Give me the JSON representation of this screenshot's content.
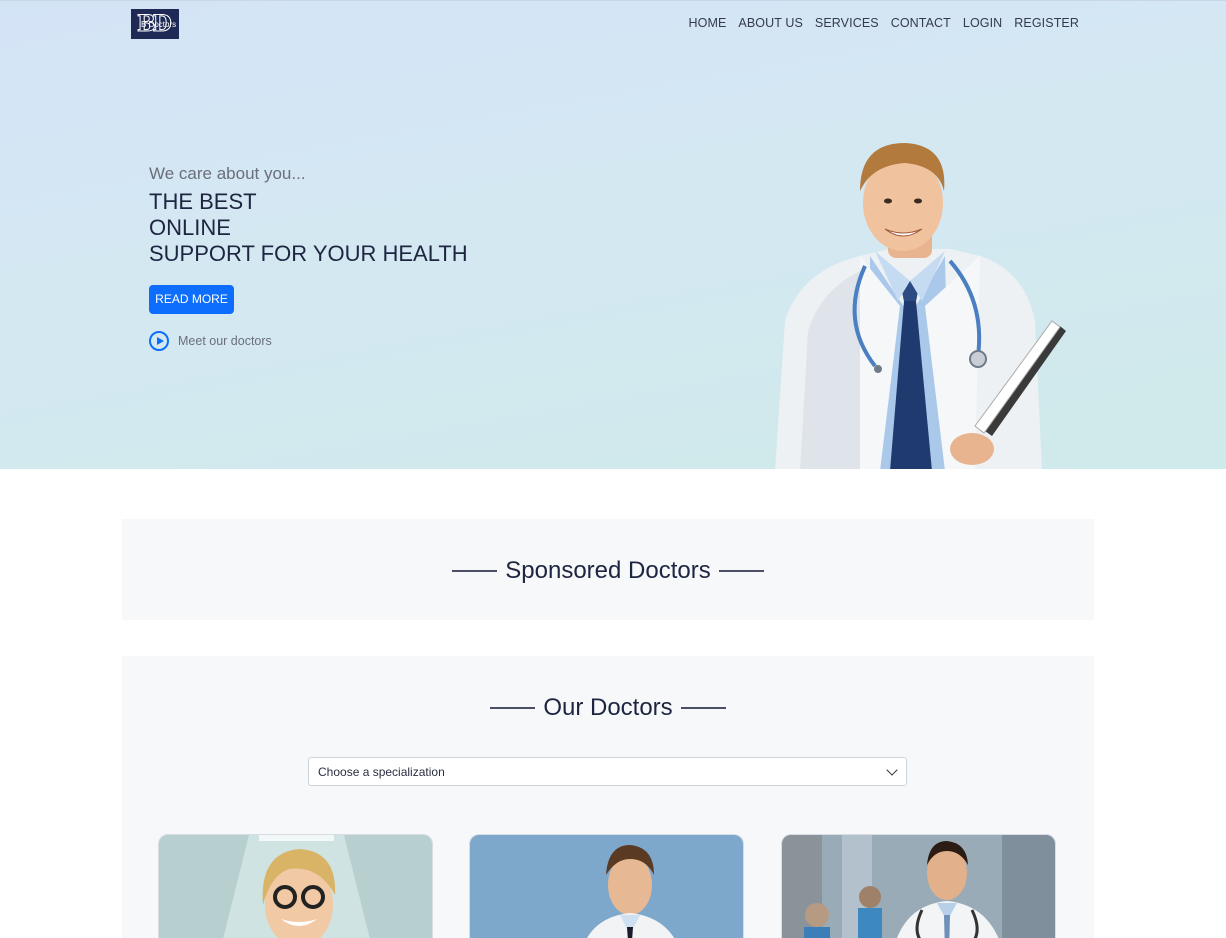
{
  "header": {
    "logo_text": "BD",
    "logo_subtext": "B Doctors",
    "nav": [
      {
        "label": "HOME"
      },
      {
        "label": "ABOUT US"
      },
      {
        "label": "SERVICES"
      },
      {
        "label": "CONTACT"
      },
      {
        "label": "LOGIN"
      },
      {
        "label": "REGISTER"
      }
    ]
  },
  "hero": {
    "tagline": "We care about you...",
    "headline_lines": [
      "THE BEST",
      "ONLINE",
      "SUPPORT FOR YOUR HEALTH"
    ],
    "read_more_label": "READ MORE",
    "meet_label": "Meet our doctors",
    "image": "doctor-with-stethoscope-and-clipboard"
  },
  "sponsored": {
    "title": "Sponsored Doctors"
  },
  "our_doctors": {
    "title": "Our Doctors",
    "specialization_select": {
      "selected": "Choose a specialization"
    },
    "cards": [
      {
        "image": "female-doctor-with-glasses"
      },
      {
        "image": "male-doctor-blue-background"
      },
      {
        "image": "male-doctor-hospital-hallway"
      }
    ]
  },
  "colors": {
    "accent": "#0d6efd",
    "heading": "#1e2541",
    "logo_bg": "#1e2a55",
    "section_bg": "#f7f8fa"
  }
}
